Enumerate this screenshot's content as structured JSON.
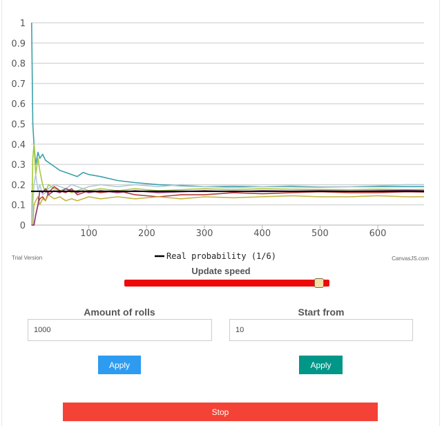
{
  "chart_data": {
    "type": "line",
    "xlim": [
      0,
      680
    ],
    "ylim": [
      0,
      1
    ],
    "x_ticks": [
      100,
      200,
      300,
      400,
      500,
      600
    ],
    "y_ticks": [
      0,
      0.1,
      0.2,
      0.3,
      0.4,
      0.5,
      0.6,
      0.7,
      0.8,
      0.9,
      1
    ],
    "grid": "horizontal",
    "legend_position": "bottom-center",
    "reference_line": {
      "name": "Real probability (1/6)",
      "value": 0.1667,
      "color": "#000000"
    },
    "series": [
      {
        "color": "#3ba0a9",
        "x": [
          1,
          3,
          5,
          8,
          12,
          15,
          20,
          25,
          30,
          40,
          50,
          60,
          70,
          80,
          90,
          100,
          120,
          150,
          180,
          220,
          260,
          300,
          350,
          400,
          450,
          500,
          550,
          600,
          650,
          680
        ],
        "y": [
          1.0,
          0.5,
          0.4,
          0.3,
          0.36,
          0.33,
          0.35,
          0.32,
          0.31,
          0.29,
          0.27,
          0.26,
          0.25,
          0.24,
          0.26,
          0.25,
          0.24,
          0.22,
          0.21,
          0.2,
          0.195,
          0.19,
          0.192,
          0.19,
          0.19,
          0.188,
          0.19,
          0.19,
          0.19,
          0.19
        ]
      },
      {
        "color": "#a3c93a",
        "x": [
          1,
          3,
          5,
          8,
          12,
          15,
          20,
          25,
          30,
          40,
          50,
          60,
          70,
          80,
          90,
          100,
          120,
          150,
          180,
          220,
          260,
          300,
          350,
          400,
          450,
          500,
          550,
          600,
          650,
          680
        ],
        "y": [
          0.0,
          0.33,
          0.4,
          0.25,
          0.33,
          0.27,
          0.2,
          0.16,
          0.2,
          0.18,
          0.17,
          0.18,
          0.16,
          0.17,
          0.18,
          0.17,
          0.18,
          0.17,
          0.18,
          0.17,
          0.175,
          0.18,
          0.175,
          0.18,
          0.177,
          0.176,
          0.175,
          0.177,
          0.175,
          0.176
        ]
      },
      {
        "color": "#b0c9d6",
        "x": [
          1,
          3,
          5,
          8,
          12,
          15,
          20,
          25,
          30,
          40,
          50,
          60,
          70,
          80,
          90,
          100,
          120,
          150,
          180,
          220,
          260,
          300,
          350,
          400,
          450,
          500,
          550,
          600,
          650,
          680
        ],
        "y": [
          0.0,
          0.1,
          0.2,
          0.25,
          0.17,
          0.2,
          0.15,
          0.16,
          0.18,
          0.2,
          0.19,
          0.18,
          0.2,
          0.19,
          0.18,
          0.19,
          0.2,
          0.19,
          0.2,
          0.19,
          0.2,
          0.19,
          0.185,
          0.19,
          0.195,
          0.19,
          0.19,
          0.195,
          0.2,
          0.2
        ]
      },
      {
        "color": "#b53a3a",
        "x": [
          1,
          3,
          5,
          8,
          12,
          15,
          20,
          25,
          30,
          40,
          50,
          60,
          70,
          80,
          90,
          100,
          120,
          150,
          180,
          220,
          260,
          300,
          350,
          400,
          450,
          500,
          550,
          600,
          650,
          680
        ],
        "y": [
          0.0,
          0.0,
          0.0,
          0.05,
          0.1,
          0.13,
          0.14,
          0.12,
          0.16,
          0.19,
          0.17,
          0.16,
          0.18,
          0.15,
          0.16,
          0.17,
          0.16,
          0.17,
          0.15,
          0.14,
          0.15,
          0.15,
          0.16,
          0.155,
          0.16,
          0.165,
          0.16,
          0.16,
          0.165,
          0.163
        ]
      },
      {
        "color": "#c4b43a",
        "x": [
          1,
          3,
          5,
          8,
          12,
          15,
          20,
          25,
          30,
          40,
          50,
          60,
          70,
          80,
          90,
          100,
          120,
          150,
          180,
          220,
          260,
          300,
          350,
          400,
          450,
          500,
          550,
          600,
          650,
          680
        ],
        "y": [
          0.0,
          0.0,
          0.1,
          0.12,
          0.14,
          0.1,
          0.13,
          0.12,
          0.15,
          0.13,
          0.14,
          0.12,
          0.13,
          0.12,
          0.13,
          0.14,
          0.13,
          0.14,
          0.13,
          0.14,
          0.13,
          0.14,
          0.135,
          0.14,
          0.145,
          0.14,
          0.14,
          0.145,
          0.14,
          0.14
        ]
      },
      {
        "color": "#8a3a78",
        "x": [
          1,
          3,
          5,
          8,
          12,
          15,
          20,
          25,
          30,
          40,
          50,
          60,
          70,
          80,
          90,
          100,
          120,
          150,
          180,
          220,
          260,
          300,
          350,
          400,
          450,
          500,
          550,
          600,
          650,
          680
        ],
        "y": [
          0.0,
          0.0,
          0.0,
          0.05,
          0.1,
          0.17,
          0.16,
          0.18,
          0.15,
          0.17,
          0.16,
          0.18,
          0.17,
          0.16,
          0.17,
          0.16,
          0.17,
          0.16,
          0.17,
          0.16,
          0.165,
          0.17,
          0.165,
          0.17,
          0.168,
          0.17,
          0.168,
          0.17,
          0.172,
          0.17
        ]
      }
    ]
  },
  "credits": {
    "left": "Trial Version",
    "right": "CanvasJS.com"
  },
  "controls": {
    "speed_title": "Update speed",
    "speed_value": 0.97,
    "rolls_title": "Amount of rolls",
    "rolls_value": "1000",
    "start_title": "Start from",
    "start_value": "10",
    "apply_label": "Apply",
    "stop_label": "Stop"
  }
}
